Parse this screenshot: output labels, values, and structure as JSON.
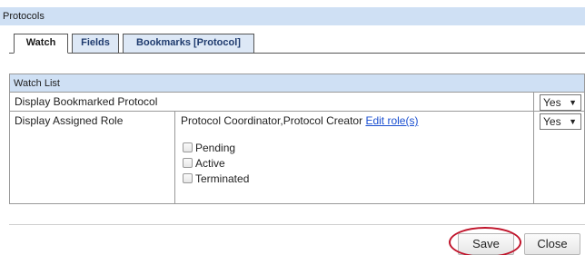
{
  "panel": {
    "title": "Protocols"
  },
  "tabs": [
    {
      "label": "Watch",
      "active": true
    },
    {
      "label": "Fields",
      "active": false
    },
    {
      "label": "Bookmarks [Protocol]",
      "active": false
    }
  ],
  "watch_list": {
    "header": "Watch List",
    "rows": [
      {
        "label": "Display Bookmarked Protocol",
        "select_value": "Yes"
      },
      {
        "label": "Display Assigned Role",
        "roles_text": "Protocol Coordinator,Protocol Creator",
        "edit_link": "Edit role(s)",
        "select_value": "Yes",
        "statuses": [
          {
            "label": "Pending",
            "checked": false
          },
          {
            "label": "Active",
            "checked": false
          },
          {
            "label": "Terminated",
            "checked": false
          }
        ]
      }
    ]
  },
  "actions": {
    "save_label": "Save",
    "close_label": "Close"
  },
  "colors": {
    "header_bg": "#cfe0f4",
    "link": "#1a4fd1",
    "highlight": "#c0142b"
  }
}
